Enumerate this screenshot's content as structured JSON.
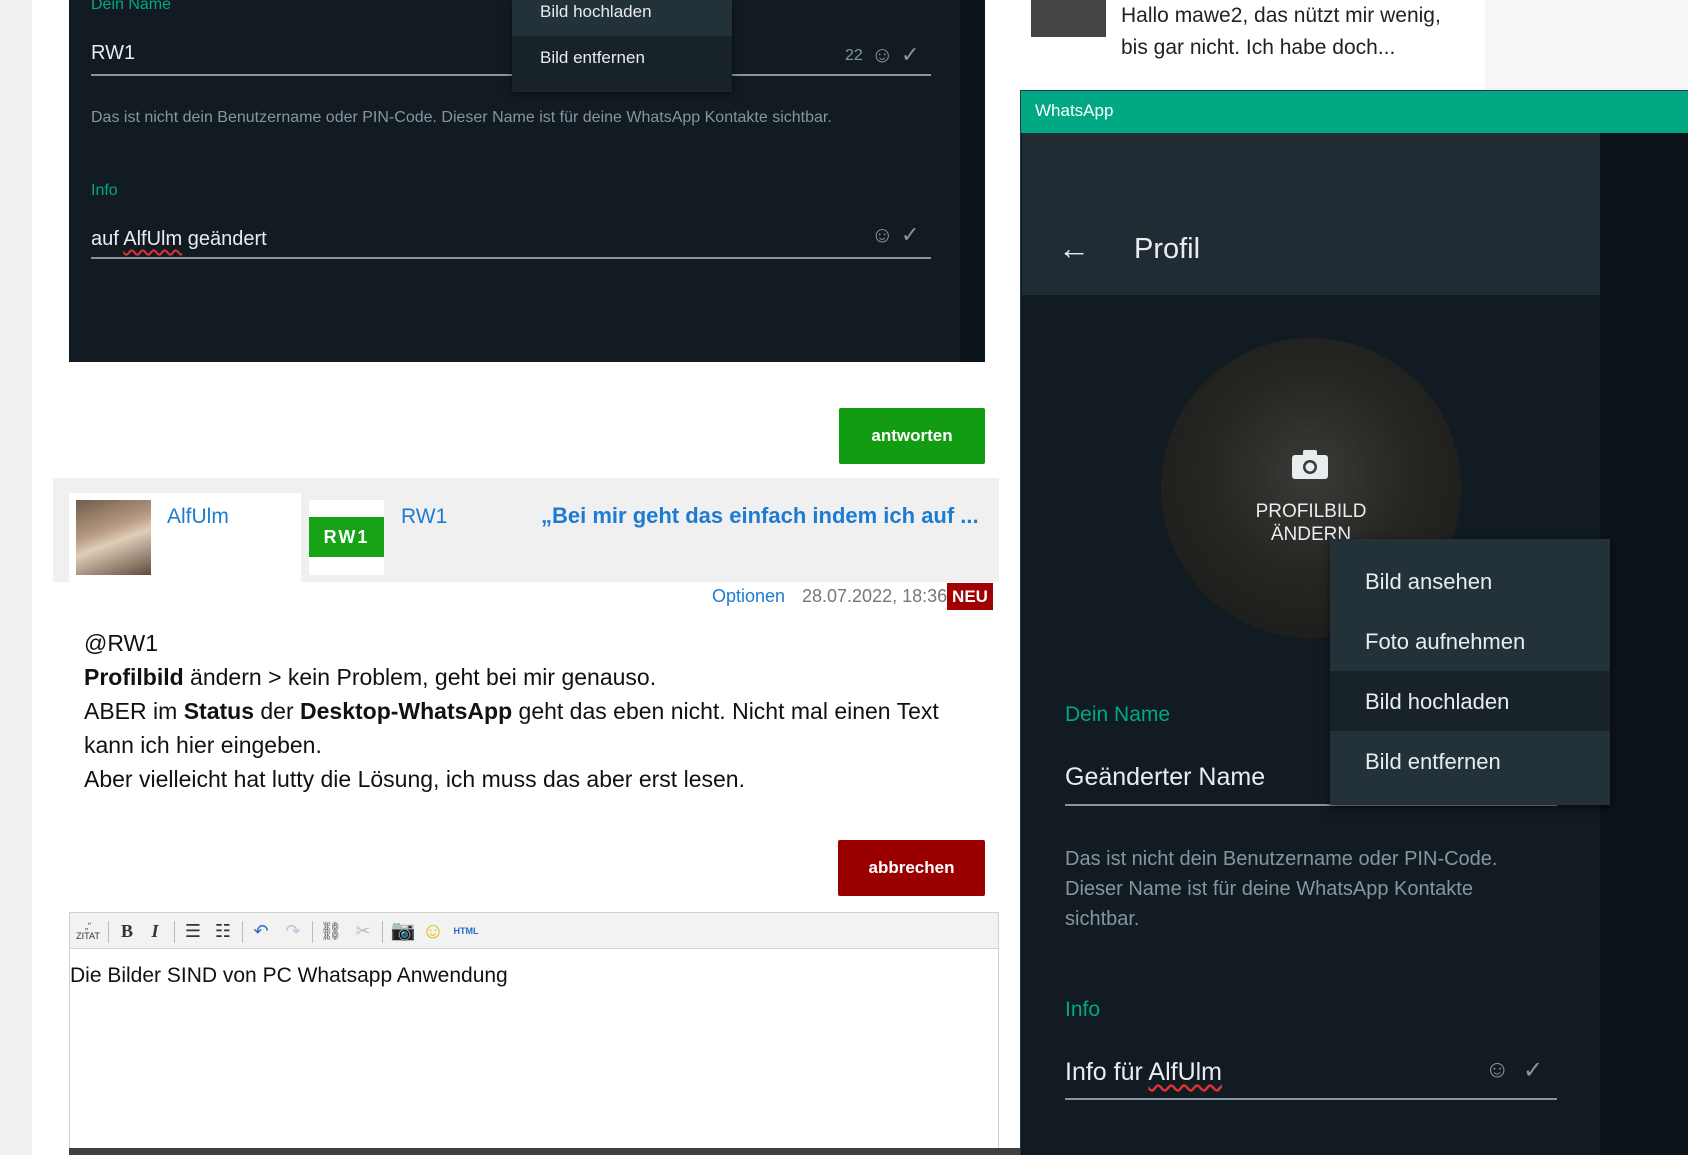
{
  "top_screenshot": {
    "name_label": "Dein Name",
    "name_value": "RW1",
    "char_count": "22",
    "hint": "Das ist nicht dein Benutzername oder PIN-Code. Dieser Name ist für deine WhatsApp Kontakte sichtbar.",
    "info_label": "Info",
    "info_value_prefix": "auf ",
    "info_value_name": "AlfUlm",
    "info_value_suffix": " geändert",
    "menu": [
      "Bild hochladen",
      "Bild entfernen"
    ]
  },
  "forum": {
    "answer_button": "antworten",
    "quote": {
      "user1": "AlfUlm",
      "user2": "RW1",
      "user2_logo": "RW1",
      "text": "„Bei mir geht das einfach indem ich auf ..."
    },
    "meta": {
      "options": "Optionen",
      "date": "28.07.2022, 18:36",
      "badge": "NEU"
    },
    "post": {
      "line1": "@RW1",
      "line2_b1": "Profilbild",
      "line2_rest": " ändern > kein Problem, geht bei mir genauso.",
      "line3_a": "ABER im ",
      "line3_b1": "Status",
      "line3_c": " der ",
      "line3_b2": "Desktop-WhatsApp",
      "line3_d": " geht das eben nicht. Nicht mal einen Text kann ich hier eingeben.",
      "line4": "Aber vielleicht hat lutty die Lösung, ich muss das aber erst lesen."
    },
    "cancel_button": "abbrechen",
    "toolbar": {
      "quote": "ZITAT",
      "bold": "B",
      "italic": "I",
      "html": "HTML"
    },
    "editor_text": "Die Bilder SIND von PC Whatsapp Anwendung"
  },
  "right_snippet": {
    "line1": "Hallo mawe2, das nützt mir wenig,",
    "line2": "bis gar nicht. Ich habe doch..."
  },
  "whatsapp": {
    "window_title": "WhatsApp",
    "header_title": "Profil",
    "avatar_label_1": "PROFILBILD",
    "avatar_label_2": "ÄNDERN",
    "menu": [
      "Bild ansehen",
      "Foto aufnehmen",
      "Bild hochladen",
      "Bild entfernen"
    ],
    "name_label": "Dein Name",
    "name_value": "Geänderter Name",
    "hint": "Das ist nicht dein Benutzername oder PIN-Code. Dieser Name ist für deine WhatsApp Kontakte sichtbar.",
    "info_label": "Info",
    "info_value_prefix": "Info für ",
    "info_value_name": "AlfUlm",
    "accent_color": "#00a884"
  }
}
